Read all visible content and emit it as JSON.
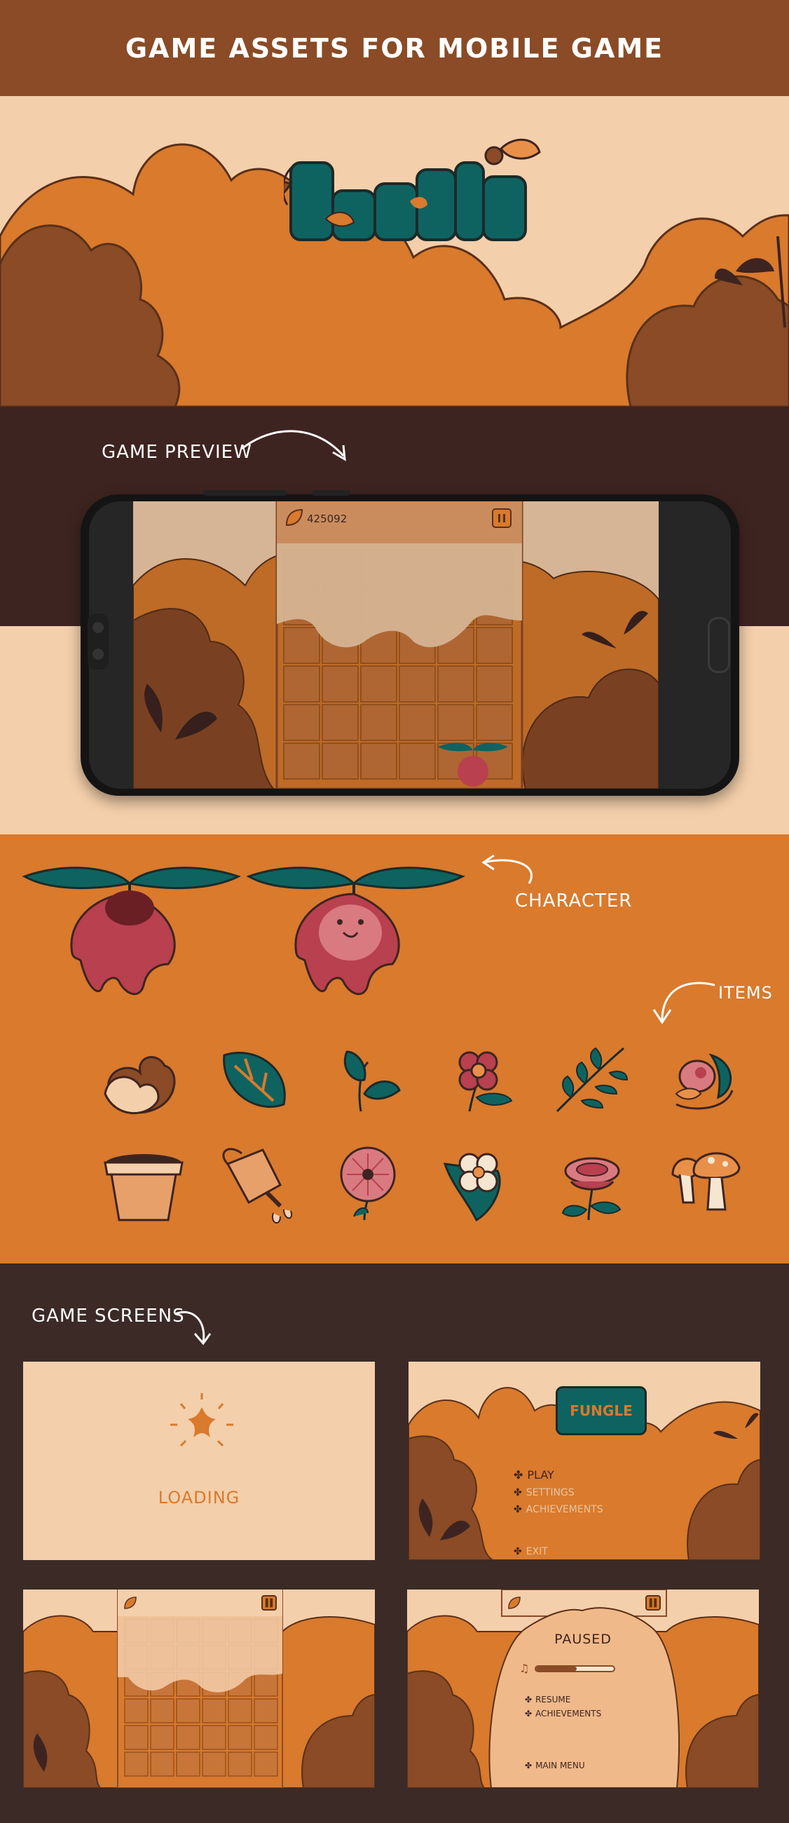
{
  "header": {
    "title": "GAME ASSETS FOR MOBILE GAME"
  },
  "logo": {
    "text": "FUNGLE"
  },
  "preview": {
    "label": "GAME PREVIEW",
    "score": "425092"
  },
  "assets": {
    "character_label": "CHARACTER",
    "items_label": "ITEMS",
    "items_row1": [
      "oak-leaf-icon",
      "monstera-leaf-icon",
      "sprout-icon",
      "red-flower-icon",
      "fern-branch-icon",
      "flower-bud-icon"
    ],
    "items_row2": [
      "flower-pot-icon",
      "watering-can-icon",
      "pink-poppy-icon",
      "white-flower-icon",
      "pink-rose-icon",
      "mushroom-icon"
    ]
  },
  "screens": {
    "label": "GAME SCREENS",
    "loading_text": "LOADING",
    "menu": {
      "logo": "FUNGLE",
      "items": [
        "PLAY",
        "SETTINGS",
        "ACHIEVEMENTS",
        "EXIT"
      ]
    },
    "paused": {
      "title": "PAUSED",
      "items": [
        "RESUME",
        "ACHIEVEMENTS",
        "MAIN MENU"
      ]
    }
  },
  "colors": {
    "title_bar": "#8a4b26",
    "hero_bg": "#f4cfab",
    "orange": "#d97a2d",
    "dark_brown": "#3e2420",
    "teal": "#0e6360",
    "crimson": "#b8404f"
  }
}
